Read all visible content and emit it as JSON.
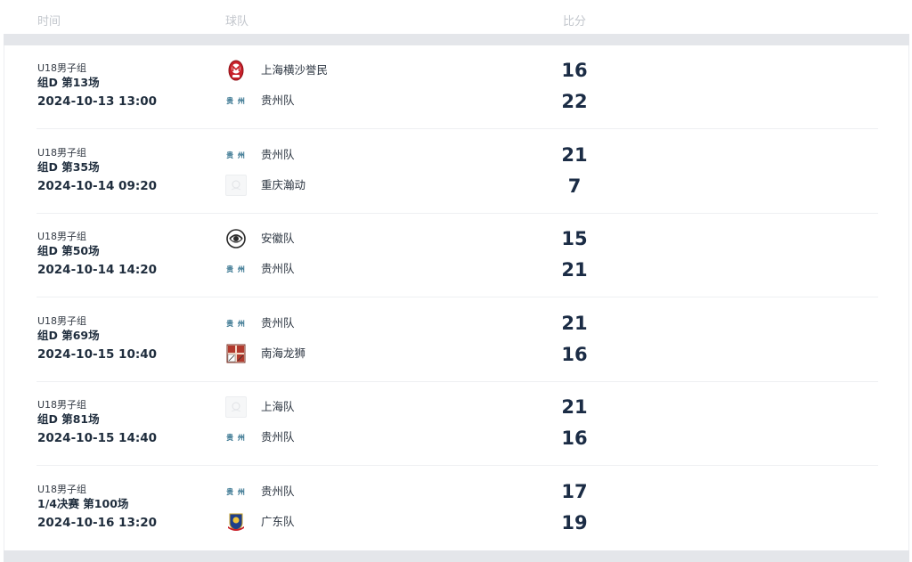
{
  "header": {
    "time_label": "时间",
    "team_label": "球队",
    "score_label": "比分"
  },
  "matches": [
    {
      "category": "U18男子组",
      "round": "组D 第13场",
      "time": "2024-10-13 13:00",
      "home": {
        "name": "上海横沙誉民",
        "logo": "red-m-badge-icon"
      },
      "away": {
        "name": "贵州队",
        "logo": "guizhou-text-logo-icon"
      },
      "home_score": "16",
      "away_score": "22"
    },
    {
      "category": "U18男子组",
      "round": "组D 第35场",
      "time": "2024-10-14 09:20",
      "home": {
        "name": "贵州队",
        "logo": "guizhou-text-logo-icon"
      },
      "away": {
        "name": "重庆瀚动",
        "logo": "placeholder-logo-icon"
      },
      "home_score": "21",
      "away_score": "7"
    },
    {
      "category": "U18男子组",
      "round": "组D 第50场",
      "time": "2024-10-14 14:20",
      "home": {
        "name": "安徽队",
        "logo": "anhui-round-badge-icon"
      },
      "away": {
        "name": "贵州队",
        "logo": "guizhou-text-logo-icon"
      },
      "home_score": "15",
      "away_score": "21"
    },
    {
      "category": "U18男子组",
      "round": "组D 第69场",
      "time": "2024-10-15 10:40",
      "home": {
        "name": "贵州队",
        "logo": "guizhou-text-logo-icon"
      },
      "away": {
        "name": "南海龙狮",
        "logo": "nanhai-shield-logo-icon"
      },
      "home_score": "21",
      "away_score": "16"
    },
    {
      "category": "U18男子组",
      "round": "组D 第81场",
      "time": "2024-10-15 14:40",
      "home": {
        "name": "上海队",
        "logo": "placeholder-logo-icon"
      },
      "away": {
        "name": "贵州队",
        "logo": "guizhou-text-logo-icon"
      },
      "home_score": "21",
      "away_score": "16"
    },
    {
      "category": "U18男子组",
      "round": "1/4决赛 第100场",
      "time": "2024-10-16 13:20",
      "home": {
        "name": "贵州队",
        "logo": "guizhou-text-logo-icon"
      },
      "away": {
        "name": "广东队",
        "logo": "guangdong-crest-logo-icon"
      },
      "home_score": "17",
      "away_score": "19"
    }
  ],
  "logo_text": {
    "guizhou": "贵 州"
  },
  "colors": {
    "score": "#1b2c45",
    "band": "#e4e6ea",
    "header_text": "#c3c7cd",
    "guizhou_logo": "#2b6c89"
  }
}
